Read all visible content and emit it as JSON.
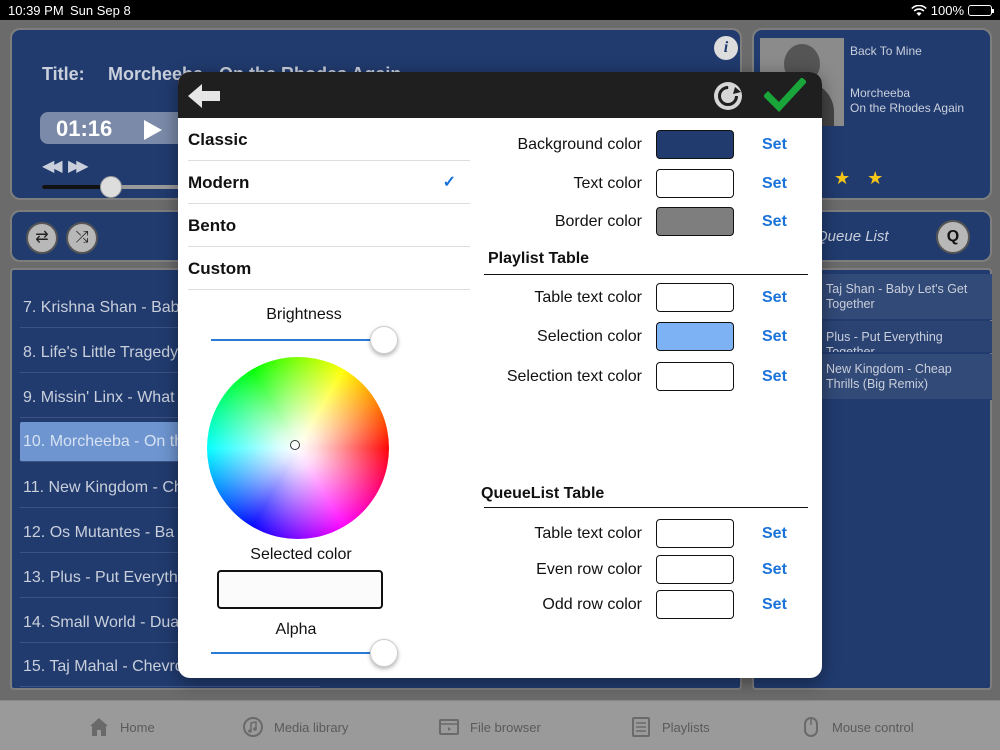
{
  "status_bar": {
    "time": "10:39 PM",
    "date": "Sun Sep 8",
    "battery": "100%"
  },
  "now_playing": {
    "title_label": "Title:",
    "title_value": "Morcheeba - On the Rhodes Again",
    "elapsed": "01:16",
    "seek_progress": 0.45
  },
  "album": {
    "album_name": "Back To Mine",
    "artist": "Morcheeba",
    "track": "On the Rhodes Again",
    "rating_stars": "★ ★"
  },
  "queue": {
    "title": "Queue List",
    "button_label": "Q",
    "items": [
      "Taj Shan - Baby Let's Get Together",
      "Plus - Put Everything Together",
      "New Kingdom - Cheap Thrills (Big Remix)"
    ]
  },
  "playlist": {
    "items": [
      "7. Krishna Shan - Baby Let's Get Together",
      "8. Life's Little Tragedy",
      "9. Missin' Linx - What",
      "10. Morcheeba - On the Rhodes Again",
      "11. New Kingdom - Cheap Thrills",
      "12. Os Mutantes - Ba",
      "13. Plus - Put Everything Together",
      "14. Small World - Dua",
      "15. Taj Mahal - Chevrolet"
    ],
    "selected_index": 3
  },
  "tabbar": {
    "tabs": [
      "Home",
      "Media library",
      "File browser",
      "Playlists",
      "Mouse control"
    ]
  },
  "dialog": {
    "themes": [
      "Classic",
      "Modern",
      "Bento",
      "Custom"
    ],
    "selected_theme_index": 1,
    "check_mark": "✓",
    "brightness_label": "Brightness",
    "brightness_value": 1.0,
    "selected_color_label": "Selected color",
    "selected_color": "#fbfbfb",
    "alpha_label": "Alpha",
    "alpha_value": 1.0,
    "set_label": "Set",
    "general_rows": [
      {
        "label": "Background color",
        "color": "#213b6f"
      },
      {
        "label": "Text color",
        "color": "#ffffff"
      },
      {
        "label": "Border color",
        "color": "#7e7e7e"
      }
    ],
    "playlist_section_title": "Playlist Table",
    "playlist_rows": [
      {
        "label": "Table text color",
        "color": "#ffffff"
      },
      {
        "label": "Selection color",
        "color": "#7db2f5"
      },
      {
        "label": "Selection text color",
        "color": "#ffffff"
      }
    ],
    "queue_section_title": "QueueList Table",
    "queue_rows": [
      {
        "label": "Table text color",
        "color": "#ffffff"
      },
      {
        "label": "Even row color",
        "color": "#ffffff"
      },
      {
        "label": "Odd row color",
        "color": "#ffffff"
      }
    ]
  },
  "colors": {
    "panel_bg": "#213b6f",
    "accent_blue": "#1a73d9",
    "check_green": "#1aa53a",
    "star_yellow": "#f5c518"
  }
}
